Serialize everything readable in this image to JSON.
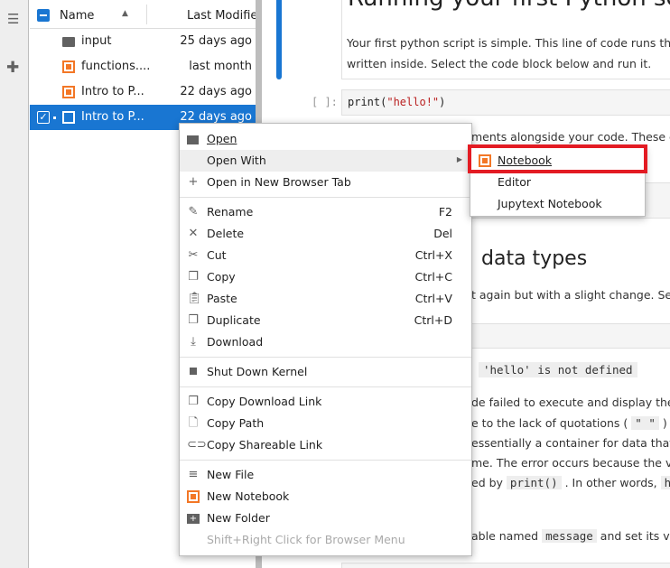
{
  "left_bar": {
    "icons": [
      "table-of-contents-icon",
      "extensions-icon"
    ]
  },
  "file_browser": {
    "header": {
      "name": "Name",
      "modified": "Last Modified"
    },
    "files": [
      {
        "name": "input",
        "modified": "25 days ago",
        "type": "folder"
      },
      {
        "name": "functions....",
        "modified": "last month",
        "type": "notebook"
      },
      {
        "name": "Intro to P...",
        "modified": "22 days ago",
        "type": "notebook"
      },
      {
        "name": "Intro to P...",
        "modified": "22 days ago",
        "type": "notebook",
        "selected": true
      }
    ]
  },
  "notebook": {
    "heading1": "Running your first Python sc",
    "para1_l1": "Your first python script is simple. This line of code runs the",
    "para1_l2": "written inside. Select the code block below and run it.",
    "prompt": "[ ]:",
    "code_fn": "print(",
    "code_str": "\"hello!\"",
    "code_end": ")",
    "frag1": "ments alongside your code. These c",
    "heading2": "data types",
    "frag2": "t again but with a slight change. Sel",
    "error": "'hello' is not defined",
    "frag3": "de failed to execute and display the t",
    "frag4a": "e to the lack of quotations (",
    "frag4code": "\" \"",
    "frag4b": ") it'",
    "frag5": "essentially a container for data that",
    "frag6": "me. The error occurs because the va",
    "frag7a": "ed by",
    "frag7code": "print()",
    "frag7b": ". In other words,",
    "frag7code2": "h",
    "frag8a": "able named",
    "frag8code": "message",
    "frag8b": "and set its va"
  },
  "context_menu": {
    "items": [
      {
        "label": "Open",
        "icon": "folder-icon"
      },
      {
        "label": "Open With",
        "submenu": true
      },
      {
        "label": "Open in New Browser Tab",
        "icon": "plus-icon"
      },
      {
        "label": "Rename",
        "shortcut": "F2",
        "icon": "pencil-icon"
      },
      {
        "label": "Delete",
        "shortcut": "Del",
        "icon": "close-icon"
      },
      {
        "label": "Cut",
        "shortcut": "Ctrl+X",
        "icon": "scissors-icon"
      },
      {
        "label": "Copy",
        "shortcut": "Ctrl+C",
        "icon": "copy-icon"
      },
      {
        "label": "Paste",
        "shortcut": "Ctrl+V",
        "icon": "paste-icon"
      },
      {
        "label": "Duplicate",
        "shortcut": "Ctrl+D",
        "icon": "duplicate-icon"
      },
      {
        "label": "Download",
        "icon": "download-icon"
      },
      {
        "label": "Shut Down Kernel",
        "icon": "stop-icon"
      },
      {
        "label": "Copy Download Link",
        "icon": "copy-icon"
      },
      {
        "label": "Copy Path",
        "icon": "file-icon"
      },
      {
        "label": "Copy Shareable Link",
        "icon": "link-icon"
      },
      {
        "label": "New File",
        "icon": "text-file-icon"
      },
      {
        "label": "New Notebook",
        "icon": "notebook-icon"
      },
      {
        "label": "New Folder",
        "icon": "new-folder-icon"
      }
    ],
    "hint": "Shift+Right Click for Browser Menu"
  },
  "submenu": {
    "items": [
      "Notebook",
      "Editor",
      "Jupytext Notebook"
    ]
  },
  "colors": {
    "accent": "#1976d2",
    "highlight": "#e31b23",
    "notebook": "#f37726"
  }
}
